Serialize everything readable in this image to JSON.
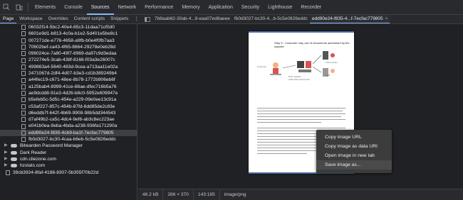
{
  "toolbar": {
    "tabs": [
      "Elements",
      "Console",
      "Sources",
      "Network",
      "Performance",
      "Memory",
      "Application",
      "Security",
      "Lighthouse",
      "Recorder"
    ],
    "active_tab": "Sources"
  },
  "sources": {
    "subtabs": [
      "Page",
      "Workspace",
      "Overrides",
      "Content scripts",
      "Snippets"
    ],
    "active_subtab": "Page",
    "file_tabs": [
      {
        "label": "7b8aab62-30ab-4...8-eaa07ed8aeee"
      },
      {
        "label": "fb0d3027-bc30-4...b-5c5e0826eddc"
      },
      {
        "label": "edd90e24-f835-4...f-7ecfac779805"
      }
    ],
    "active_file_tab": "edd90e24-f835-4...f-7ecfac779805"
  },
  "tree": {
    "files": [
      "06032f14-5bc2-40e4-85c3-11daa71cf0d0",
      "6601e9d1-b813-4c0a-b1e2-5d401e5be8c1",
      "007271de-e776-4658-a9fb-b0e4f0fb7aa3",
      "70602bef-ca43-4f65-8664-29278e0eb28d",
      "096024ce-7a80-49f7-8969-da97c9d3edaa",
      "272274e5-3cab-438f-8166-f03a3e26007c",
      "499863a4-5640-483d-9cea-a713aa11e02a",
      "2471067d-2df4-4d07-b3e3-cd1b389249b4",
      "a44fec19-c671-48ee-8b78-1772b906eb6f",
      "a125bab4-8999-41ce-88ae-dfec716b5a76",
      "ae9dcdd8-91e3-4d26-b8c0-5952e609947e",
      "b5efeb5c-5d5c-454e-a229-09e0ee13c91a",
      "c53af227-857c-454b-87fd-6dd85de2c83e",
      "d6eddb7f-642f-4b69-9908-98b5dd344543",
      "d7af49b2-ca5c-4dc4-9ef6-ab3c8ec223ae",
      "e041b0ea-9eba-4bda-a238-936fa171290a",
      "edd90e24-f835-4cb9-ba1f-7ecfac779805",
      "fb0d3027-bc30-4caa-b6eb-5c5e0826eddc"
    ],
    "selected_file": "edd90e24-f835-4cb9-ba1f-7ecfac779805",
    "groups": [
      "Bitwarden Password Manager",
      "Dark Reader",
      "cdn.cliezone.com",
      "hzstats.com"
    ],
    "last_row": "39cb3924-8faf-4188-8307-5b355f70b22d"
  },
  "preview": {
    "doc_title": "Step 5 - Customer may use of documents authorised by the supplier",
    "diagram_labels": [
      "Customer",
      "Third parties",
      "Fulfil",
      "DOX supplier",
      "Authorised documents"
    ]
  },
  "status": {
    "size": "46.2 kB",
    "dimensions": "286 × 370",
    "ratio": "143:185",
    "mime": "image/png"
  },
  "context_menu": {
    "items": [
      "Copy image URL",
      "Copy image as data URI",
      "Open image in new tab",
      "Save image as..."
    ],
    "hovered": "Save image as..."
  },
  "colors": {
    "accent": "#8ab4f8",
    "background": "#202124",
    "toolbar": "#292a2d"
  }
}
